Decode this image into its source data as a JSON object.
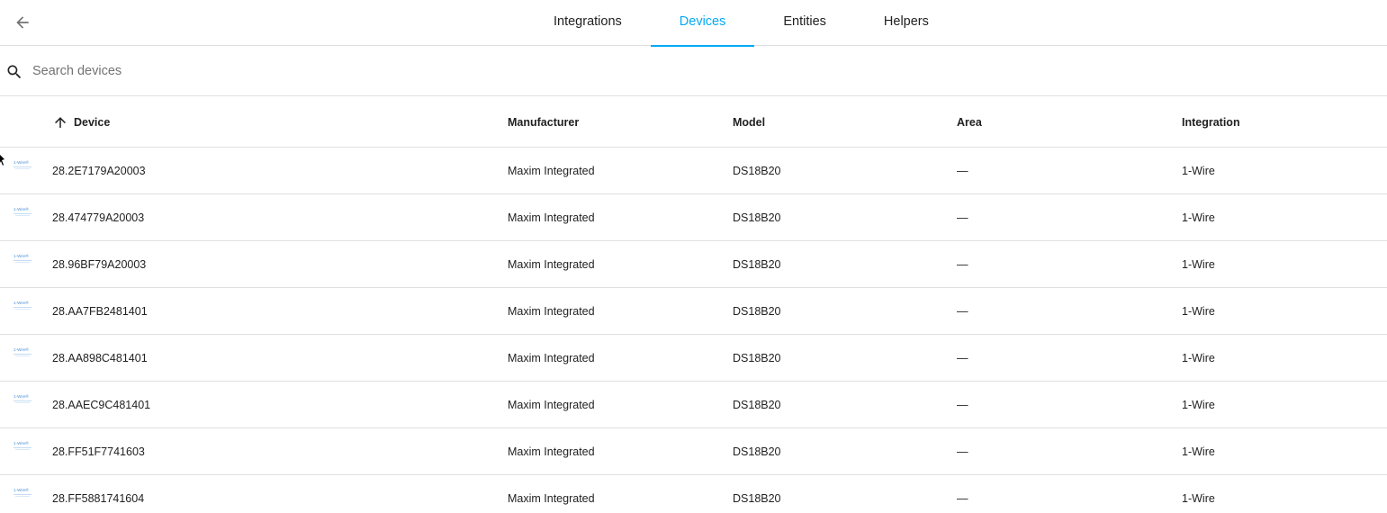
{
  "tabs": [
    {
      "label": "Integrations",
      "active": false
    },
    {
      "label": "Devices",
      "active": true
    },
    {
      "label": "Entities",
      "active": false
    },
    {
      "label": "Helpers",
      "active": false
    }
  ],
  "search": {
    "placeholder": "Search devices",
    "value": ""
  },
  "table": {
    "columns": {
      "device": "Device",
      "manufacturer": "Manufacturer",
      "model": "Model",
      "area": "Area",
      "integration": "Integration"
    },
    "sort": {
      "column": "device",
      "direction": "ascending"
    },
    "rows": [
      {
        "device": "28.2E7179A20003",
        "manufacturer": "Maxim Integrated",
        "model": "DS18B20",
        "area": "—",
        "integration": "1-Wire"
      },
      {
        "device": "28.474779A20003",
        "manufacturer": "Maxim Integrated",
        "model": "DS18B20",
        "area": "—",
        "integration": "1-Wire"
      },
      {
        "device": "28.96BF79A20003",
        "manufacturer": "Maxim Integrated",
        "model": "DS18B20",
        "area": "—",
        "integration": "1-Wire"
      },
      {
        "device": "28.AA7FB2481401",
        "manufacturer": "Maxim Integrated",
        "model": "DS18B20",
        "area": "—",
        "integration": "1-Wire"
      },
      {
        "device": "28.AA898C481401",
        "manufacturer": "Maxim Integrated",
        "model": "DS18B20",
        "area": "—",
        "integration": "1-Wire"
      },
      {
        "device": "28.AAEC9C481401",
        "manufacturer": "Maxim Integrated",
        "model": "DS18B20",
        "area": "—",
        "integration": "1-Wire"
      },
      {
        "device": "28.FF51F7741603",
        "manufacturer": "Maxim Integrated",
        "model": "DS18B20",
        "area": "—",
        "integration": "1-Wire"
      },
      {
        "device": "28.FF5881741604",
        "manufacturer": "Maxim Integrated",
        "model": "DS18B20",
        "area": "—",
        "integration": "1-Wire"
      }
    ]
  },
  "icons": {
    "back": "arrow-left-icon",
    "search": "magnify-icon",
    "sort": "arrow-up-icon",
    "row_logo": "1-wire-logo-icon"
  },
  "colors": {
    "accent": "#03a9f4",
    "divider": "#e0e0e0",
    "icon": "#727272"
  }
}
